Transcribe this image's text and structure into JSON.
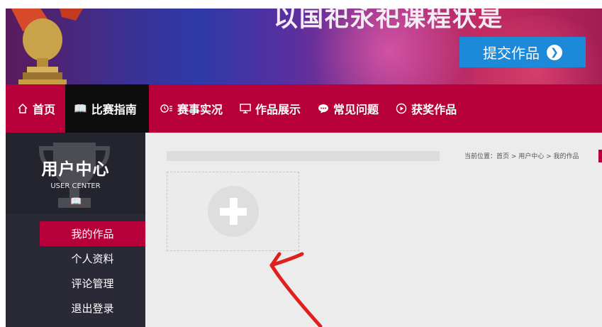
{
  "banner": {
    "title": "以国祀永祀课程状是",
    "submit_label": "提交作品",
    "submit_icon": "chevron-right-circle-icon"
  },
  "nav": {
    "items": [
      {
        "label": "首页",
        "icon": "home-icon"
      },
      {
        "label": "比赛指南",
        "icon": "book-icon",
        "active": true
      },
      {
        "label": "赛事实况",
        "icon": "clock-list-icon"
      },
      {
        "label": "作品展示",
        "icon": "monitor-icon"
      },
      {
        "label": "常见问题",
        "icon": "chat-bubble-icon"
      },
      {
        "label": "获奖作品",
        "icon": "play-circle-icon"
      }
    ]
  },
  "sidebar": {
    "title": "用户中心",
    "subtitle": "USER CENTER",
    "items": [
      {
        "label": "我的作品",
        "active": true
      },
      {
        "label": "个人资料"
      },
      {
        "label": "评论管理"
      },
      {
        "label": "退出登录"
      }
    ]
  },
  "main": {
    "breadcrumb": "当前位置：首页 > 用户中心 > 我的作品",
    "add_icon": "plus-icon"
  },
  "colors": {
    "nav_red": "#b7003a",
    "submit_blue": "#1c8ad8",
    "sidebar_dark": "#2a2a36",
    "annotation_arrow": "#e0201e"
  }
}
